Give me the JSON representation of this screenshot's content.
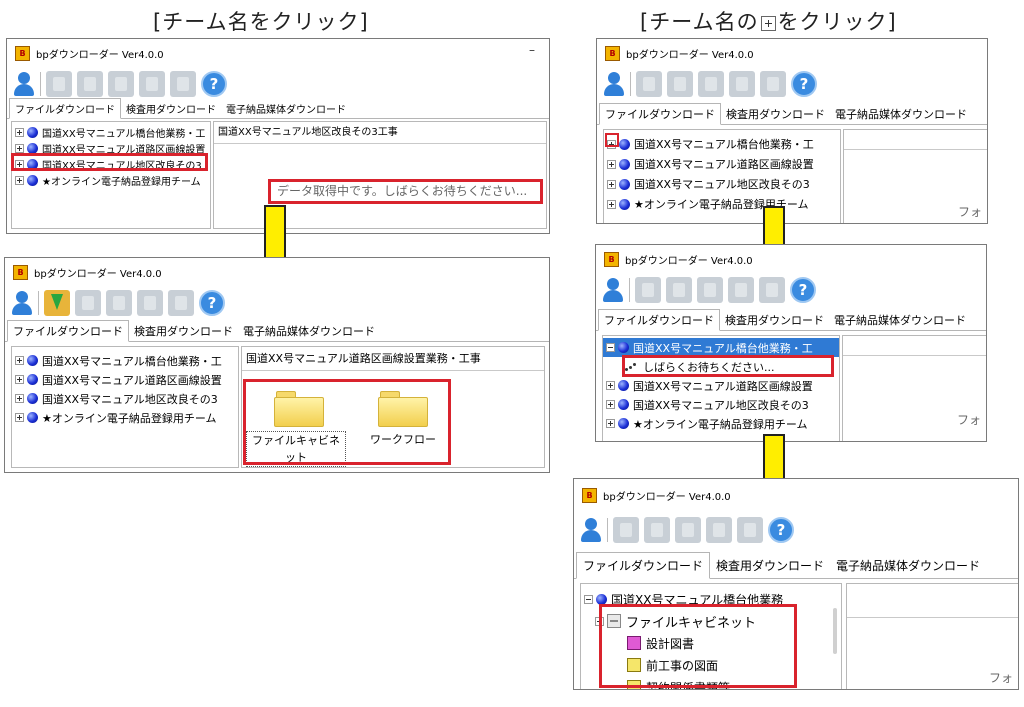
{
  "headings": {
    "left": "[チーム名をクリック]",
    "right_part1": "[チーム名の",
    "right_part2": "をクリック]"
  },
  "app": {
    "title": "bpダウンローダー Ver4.0.0",
    "minimize_symbol": "–",
    "help_symbol": "?"
  },
  "tabs": [
    "ファイルダウンロード",
    "検査用ダウンロード",
    "電子納品媒体ダウンロード"
  ],
  "tree_items": [
    "国道XX号マニュアル橋台他業務・工",
    "国道XX号マニュアル道路区画線設置",
    "国道XX号マニュアル地区改良その3",
    "★オンライン電子納品登録用チーム"
  ],
  "panel_a": {
    "right_header": "国道XX号マニュアル地区改良その3工事",
    "loading_text": "データ取得中です。しばらくお待ちください..."
  },
  "panel_b": {
    "right_header": "国道XX号マニュアル道路区画線設置業務・工事",
    "folders": [
      "ファイルキャビネット",
      "ワークフロー"
    ]
  },
  "panel_c": {
    "corner_text": "フォ"
  },
  "panel_d": {
    "loading_child": "しばらくお待ちください...",
    "corner_text": "フォ"
  },
  "panel_e": {
    "root": "国道XX号マニュアル橋台他業務",
    "cabinet": "ファイルキャビネット",
    "children": [
      "設計図書",
      "前工事の図面",
      "契約関係書類等"
    ],
    "corner_text": "フォ"
  }
}
